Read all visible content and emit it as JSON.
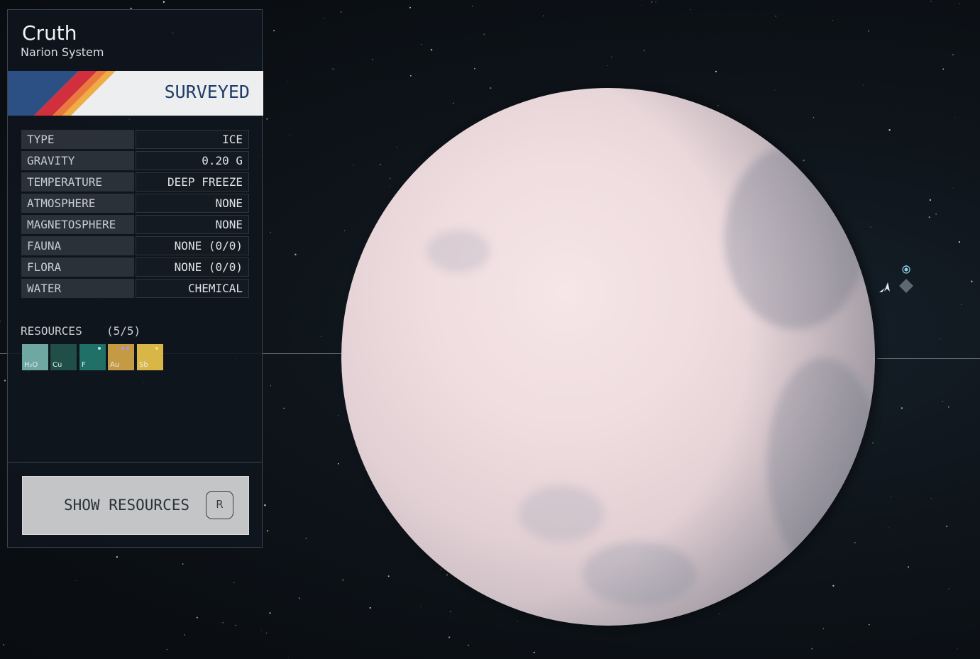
{
  "planet": {
    "name": "Cruth",
    "system": "Narion System",
    "status": "SURVEYED"
  },
  "stats": [
    {
      "label": "TYPE",
      "value": "ICE"
    },
    {
      "label": "GRAVITY",
      "value": "0.20 G"
    },
    {
      "label": "TEMPERATURE",
      "value": "DEEP FREEZE"
    },
    {
      "label": "ATMOSPHERE",
      "value": "NONE"
    },
    {
      "label": "MAGNETOSPHERE",
      "value": "NONE"
    },
    {
      "label": "FAUNA",
      "value": "NONE (0/0)"
    },
    {
      "label": "FLORA",
      "value": "NONE (0/0)"
    },
    {
      "label": "WATER",
      "value": "CHEMICAL"
    }
  ],
  "resources": {
    "label": "RESOURCES",
    "count": "(5/5)",
    "items": [
      {
        "symbol": "H₂O",
        "color": "#6fa7a3"
      },
      {
        "symbol": "Cu",
        "color": "#1f4f48"
      },
      {
        "symbol": "F",
        "color": "#217067"
      },
      {
        "symbol": "Au",
        "color": "#c49a45"
      },
      {
        "symbol": "Sb",
        "color": "#d9b747"
      }
    ]
  },
  "actions": {
    "show_resources_label": "SHOW RESOURCES",
    "show_resources_key": "R"
  },
  "colors": {
    "accent_navy": "#1e3b66",
    "stripe_blue": "#2c4f84",
    "stripe_red": "#d12f3e",
    "stripe_orange": "#ea7a3c",
    "stripe_yellow": "#f0ad45"
  },
  "icons": {
    "ship_marker": "ship-icon",
    "scan_marker": "scanner-target-icon",
    "landing_marker": "diamond-icon"
  }
}
